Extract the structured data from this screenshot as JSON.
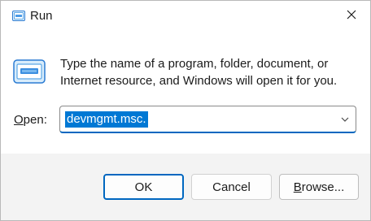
{
  "window": {
    "title": "Run",
    "app_icon": "run-icon",
    "close_icon": "close-icon"
  },
  "content": {
    "message": "Type the name of a program, folder, document, or Internet resource, and Windows will open it for you.",
    "open_label_accel": "O",
    "open_label_rest": "pen:",
    "open_value": "devmgmt.msc.",
    "dropdown_icon": "chevron-down-icon"
  },
  "buttons": {
    "ok": "OK",
    "cancel": "Cancel",
    "browse_accel": "B",
    "browse_rest": "rowse..."
  },
  "colors": {
    "accent": "#0067c0",
    "selection": "#0078d4",
    "footer_bg": "#f3f3f3"
  }
}
